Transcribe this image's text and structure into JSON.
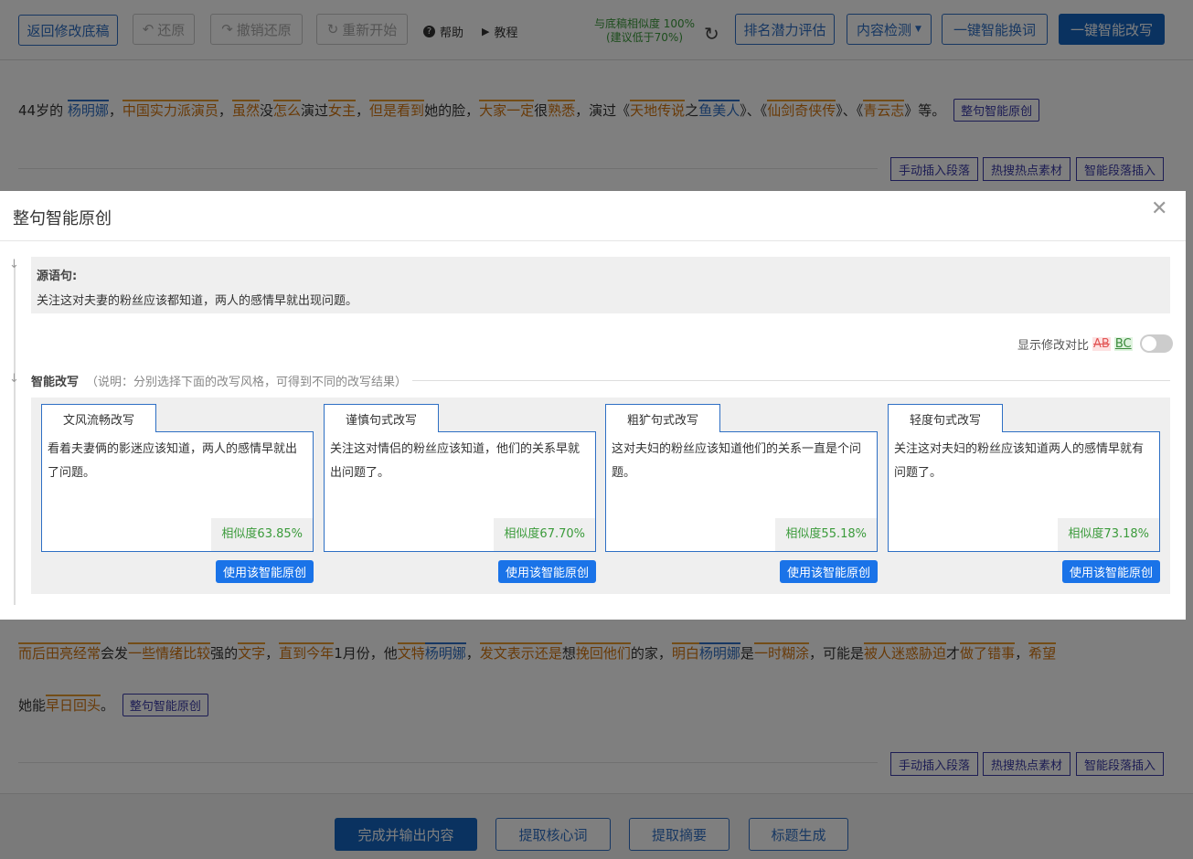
{
  "topbar": {
    "back_label": "返回修改底稿",
    "undo_label": "还原",
    "redo_label": "撤销还原",
    "restart_label": "重新开始",
    "help_label": "帮助",
    "tutorial_label": "教程",
    "similarity_line1": "与底稿相似度 100%",
    "similarity_line2": "(建议低于70%)",
    "rank_label": "排名潜力评估",
    "content_check_label": "内容检测",
    "one_click_replace_label": "一键智能换词",
    "one_click_rewrite_label": "一键智能改写"
  },
  "paragraph1": {
    "segments": [
      "44岁的 ",
      "杨明娜",
      "，",
      "中国",
      "实力派演员",
      "，",
      "虽然",
      "没",
      "怎么",
      "演过",
      "女主",
      "，",
      "但是",
      "看到",
      "她的脸，",
      "大家",
      "一定",
      "很",
      "熟悉",
      "，演过《",
      "天地传说",
      "之",
      "鱼美人",
      "》、《",
      "仙剑奇侠传",
      "》、《",
      "青云志",
      "》等。"
    ],
    "action_label": "整句智能原创"
  },
  "side_actions": {
    "manual_insert_label": "手动插入段落",
    "hot_search_label": "热搜热点素材",
    "smart_insert_label": "智能段落插入"
  },
  "paragraph2": {
    "line1": [
      "而后",
      "田亮",
      "经常",
      "会发",
      "一些",
      "情绪",
      "比较",
      "强的",
      "文字",
      "，",
      "直到",
      "今年",
      "1月份，他",
      "文特",
      "杨明娜",
      "，",
      "发文",
      "表示",
      "还是",
      "想",
      "挽回",
      "他们",
      "的家，",
      "明白",
      "杨明娜",
      "是",
      "一时",
      "糊涂",
      "，可能是",
      "被人",
      "迷惑",
      "胁迫",
      "才",
      "做了",
      "错事",
      "，",
      "希望"
    ],
    "line2": [
      "她能",
      "早日",
      "回头",
      "。"
    ],
    "action_label": "整句智能原创"
  },
  "bottom": {
    "finish_label": "完成并输出内容",
    "keywords_label": "提取核心词",
    "summary_label": "提取摘要",
    "title_label": "标题生成"
  },
  "modal": {
    "title": "整句智能原创",
    "source_label": "源语句:",
    "source_text": "关注这对夫妻的粉丝应该都知道，两人的感情早就出现问题。",
    "compare_label": "显示修改对比",
    "compare_del": "AB",
    "compare_add": "BC",
    "smart_label": "智能改写",
    "smart_note": "（说明：分别选择下面的改写风格，可得到不同的改写结果）",
    "use_label": "使用该智能原创",
    "cards": [
      {
        "tab": "文风流畅改写",
        "text": "看着夫妻俩的影迷应该知道，两人的感情早就出了问题。",
        "similarity": "相似度63.85%"
      },
      {
        "tab": "谨慎句式改写",
        "text": "关注这对情侣的粉丝应该知道，他们的关系早就出问题了。",
        "similarity": "相似度67.70%"
      },
      {
        "tab": "粗犷句式改写",
        "text": "这对夫妇的粉丝应该知道他们的关系一直是个问题。",
        "similarity": "相似度55.18%"
      },
      {
        "tab": "轻度句式改写",
        "text": "关注这对夫妇的粉丝应该知道两人的感情早就有问题了。",
        "similarity": "相似度73.18%"
      }
    ]
  }
}
